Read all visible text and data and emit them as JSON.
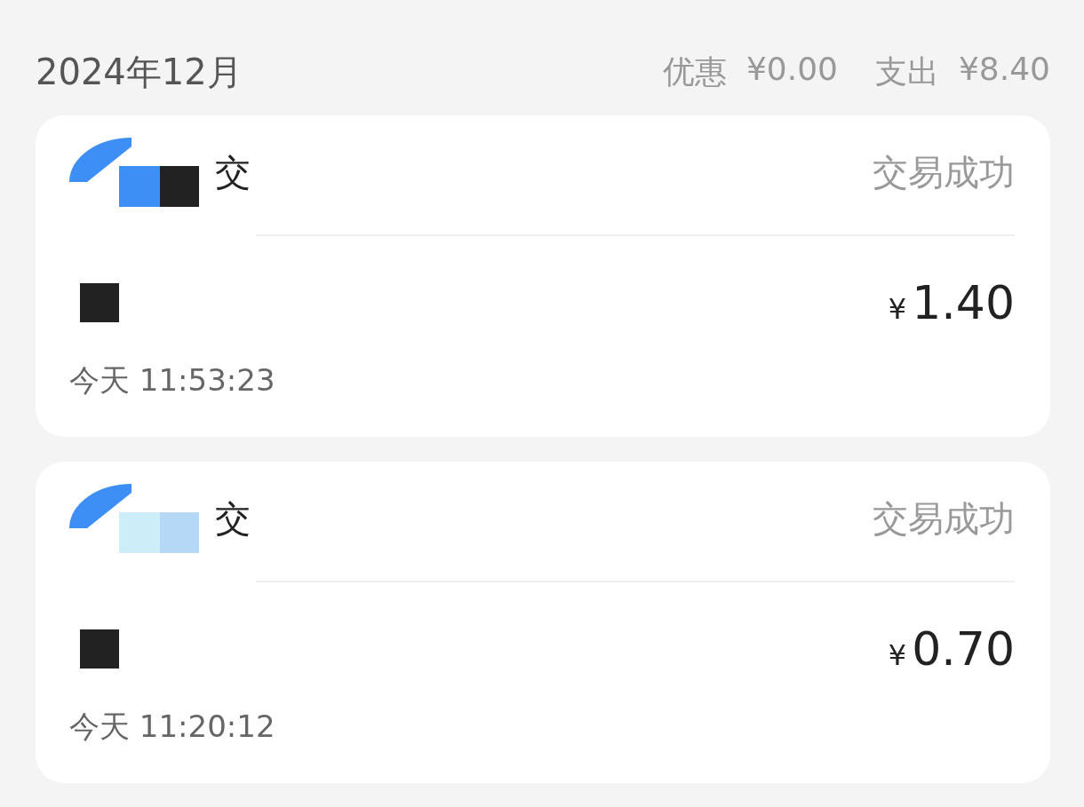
{
  "header": {
    "month": "2024年12月",
    "discount_label": "优惠",
    "discount": "¥0.00",
    "expense_label": "支出",
    "expense": "¥8.40"
  },
  "transactions": [
    {
      "title": "交",
      "status": "交易成功",
      "currency": "¥",
      "amount": "1.40",
      "time": "今天 11:53:23"
    },
    {
      "title": "交",
      "status": "交易成功",
      "currency": "¥",
      "amount": "0.70",
      "time": "今天 11:20:12"
    }
  ]
}
